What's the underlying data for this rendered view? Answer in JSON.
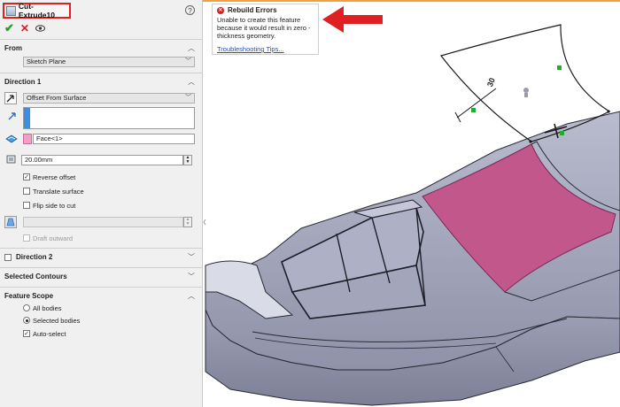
{
  "panel": {
    "title": "Cut-Extrude10",
    "help_glyph": "?",
    "ok_glyph": "✔",
    "cancel_glyph": "✕"
  },
  "from": {
    "header": "From",
    "value": "Sketch Plane"
  },
  "direction1": {
    "header": "Direction 1",
    "end_condition": "Offset From Surface",
    "face_selection": "Face<1>",
    "offset_value": "20.00mm",
    "reverse_offset": "Reverse offset",
    "translate_surface": "Translate surface",
    "flip_side": "Flip side to cut",
    "draft_outward": "Draft outward",
    "checked": {
      "reverse_offset": true,
      "translate_surface": false,
      "flip_side": false,
      "draft_outward": false
    }
  },
  "direction2": {
    "header": "Direction 2"
  },
  "selected_contours": {
    "header": "Selected Contours"
  },
  "feature_scope": {
    "header": "Feature Scope",
    "all_bodies": "All bodies",
    "selected_bodies": "Selected bodies",
    "auto_select": "Auto-select",
    "selected": "Selected bodies",
    "auto_select_checked": true
  },
  "tooltip": {
    "title": "Rebuild Errors",
    "message": "Unable to create this feature because it would result in zero -thickness geometry.",
    "link": "Troubleshooting Tips..."
  },
  "viewport": {
    "dimension_label": "30"
  },
  "colors": {
    "accent_red": "#e02020",
    "face_pink": "#c2578c",
    "model_gray": "#a9abc1"
  }
}
